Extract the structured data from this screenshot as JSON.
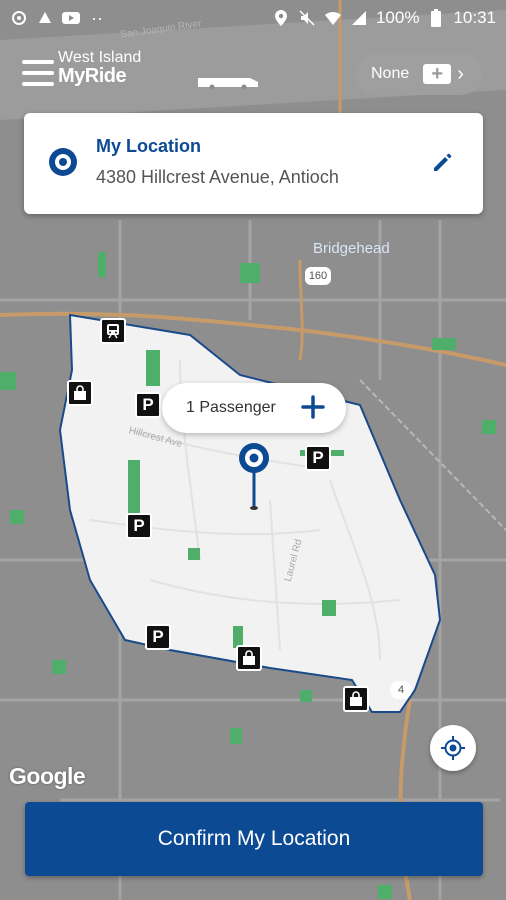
{
  "status_bar": {
    "battery": "100%",
    "time": "10:31",
    "left_icons": [
      "sync-icon",
      "drive-icon",
      "youtube-icon",
      "more-dots-icon"
    ],
    "right_icons": [
      "location-icon",
      "mute-icon",
      "wifi-icon",
      "signal-icon",
      "battery-icon"
    ]
  },
  "header": {
    "logo_line1": "West Island",
    "logo_line2": "MyRide",
    "service_filter_label": "None"
  },
  "location_card": {
    "title": "My Location",
    "address": "4380 Hillcrest Avenue, Antioch"
  },
  "map": {
    "place_label": "Bridgehead",
    "road_labels": [
      "Hillcrest Ave",
      "Laurel Rd",
      "San Joaquin River"
    ],
    "highway_shields": [
      "160",
      "4"
    ],
    "attribution": "Google"
  },
  "passenger_bubble": {
    "label": "1 Passenger"
  },
  "confirm_button": {
    "label": "Confirm My Location"
  },
  "colors": {
    "brand_blue": "#0d4a94",
    "zone_fill": "#f2f2f2",
    "map_background": "#8d8d8d",
    "park_green": "#3cb371"
  },
  "markers": {
    "transit": [
      "train-icon"
    ],
    "parking_letter": "P",
    "shopping": [
      "shopping-bag-icon"
    ]
  }
}
